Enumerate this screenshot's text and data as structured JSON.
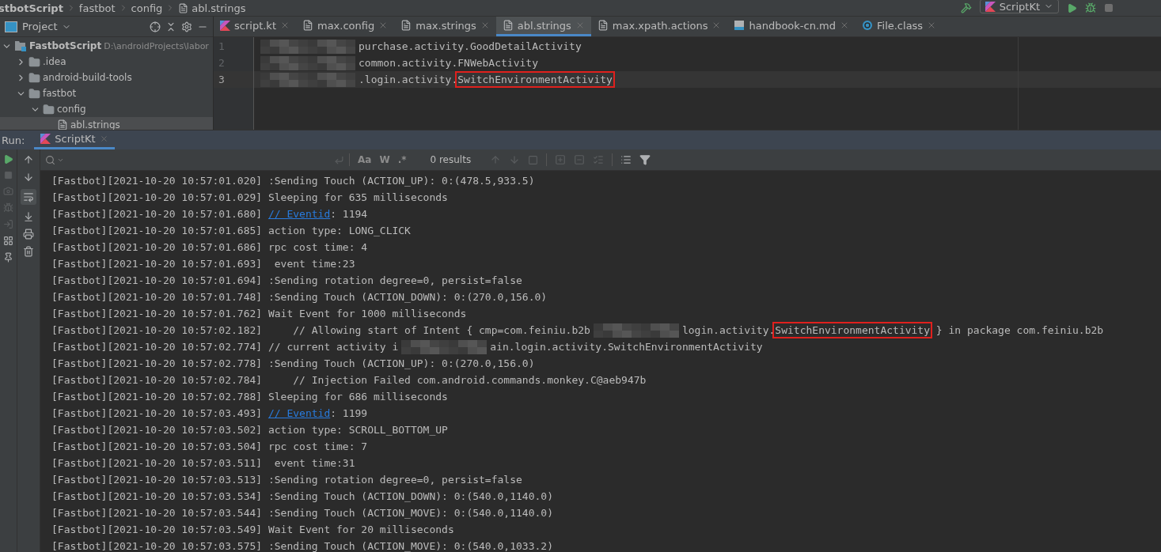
{
  "breadcrumb": [
    "stbotScript",
    "fastbot",
    "config",
    "abl.strings"
  ],
  "toolbar": {
    "run_config": "ScriptKt"
  },
  "project_panel": {
    "title": "Project",
    "tree": [
      {
        "label": "FastbotScript",
        "path": "D:\\androidProjects\\labor",
        "kind": "module",
        "expanded": true,
        "selected": false,
        "children": [
          {
            "label": ".idea",
            "kind": "folder",
            "expanded": false,
            "selected": false
          },
          {
            "label": "android-build-tools",
            "kind": "folder",
            "expanded": false,
            "selected": false
          },
          {
            "label": "fastbot",
            "kind": "folder",
            "expanded": true,
            "selected": false,
            "children": [
              {
                "label": "config",
                "kind": "folder",
                "expanded": true,
                "selected": false,
                "children": [
                  {
                    "label": "abl.strings",
                    "kind": "file",
                    "selected": true
                  }
                ]
              }
            ]
          }
        ]
      }
    ]
  },
  "editor": {
    "tabs": [
      {
        "label": "script.kt",
        "kind": "kotlin",
        "selected": false
      },
      {
        "label": "max.config",
        "kind": "text",
        "selected": false
      },
      {
        "label": "max.strings",
        "kind": "text",
        "selected": false
      },
      {
        "label": "abl.strings",
        "kind": "text",
        "selected": true
      },
      {
        "label": "max.xpath.actions",
        "kind": "text",
        "selected": false
      },
      {
        "label": "handbook-cn.md",
        "kind": "markdown",
        "selected": false
      },
      {
        "label": "File.class",
        "kind": "class",
        "selected": false
      }
    ],
    "lines": [
      {
        "number": "1",
        "current": false,
        "parts": [
          {
            "kind": "redacted"
          },
          {
            "kind": "text",
            "text": "purchase.activity.GoodDetailActivity"
          }
        ]
      },
      {
        "number": "2",
        "current": false,
        "parts": [
          {
            "kind": "redacted"
          },
          {
            "kind": "text",
            "text": "common.activity.FNWebActivity"
          }
        ]
      },
      {
        "number": "3",
        "current": true,
        "parts": [
          {
            "kind": "redacted"
          },
          {
            "kind": "text",
            "text": ".login.activity."
          },
          {
            "kind": "boxed",
            "text": "SwitchEnvironmentActivity"
          }
        ]
      }
    ]
  },
  "run": {
    "label": "Run:",
    "tab": "ScriptKt",
    "search": {
      "results": "0 results",
      "options": [
        "Aa",
        "W",
        ".*"
      ]
    },
    "log": [
      {
        "time": "[Fastbot][2021-10-20 10:57:01.020]",
        "parts": [
          {
            "kind": "text",
            "text": ":Sending Touch (ACTION_UP): 0:(478.5,933.5)"
          }
        ]
      },
      {
        "time": "[Fastbot][2021-10-20 10:57:01.029]",
        "parts": [
          {
            "kind": "text",
            "text": "Sleeping for 635 milliseconds"
          }
        ]
      },
      {
        "time": "[Fastbot][2021-10-20 10:57:01.680]",
        "parts": [
          {
            "kind": "link",
            "text": "// Eventid"
          },
          {
            "kind": "text",
            "text": ": 1194"
          }
        ]
      },
      {
        "time": "[Fastbot][2021-10-20 10:57:01.685]",
        "parts": [
          {
            "kind": "text",
            "text": "action type: LONG_CLICK"
          }
        ]
      },
      {
        "time": "[Fastbot][2021-10-20 10:57:01.686]",
        "parts": [
          {
            "kind": "text",
            "text": "rpc cost time: 4"
          }
        ]
      },
      {
        "time": "[Fastbot][2021-10-20 10:57:01.693]",
        "parts": [
          {
            "kind": "text",
            "text": " event time:23"
          }
        ]
      },
      {
        "time": "[Fastbot][2021-10-20 10:57:01.694]",
        "parts": [
          {
            "kind": "text",
            "text": ":Sending rotation degree=0, persist=false"
          }
        ]
      },
      {
        "time": "[Fastbot][2021-10-20 10:57:01.748]",
        "parts": [
          {
            "kind": "text",
            "text": ":Sending Touch (ACTION_DOWN): 0:(270.0,156.0)"
          }
        ]
      },
      {
        "time": "[Fastbot][2021-10-20 10:57:01.762]",
        "parts": [
          {
            "kind": "text",
            "text": "Wait Event for 1000 milliseconds"
          }
        ]
      },
      {
        "time": "[Fastbot][2021-10-20 10:57:02.182]",
        "parts": [
          {
            "kind": "text",
            "text": "    // Allowing start of Intent { cmp=com.feiniu.b2b"
          },
          {
            "kind": "redacted"
          },
          {
            "kind": "text",
            "text": "login.activity."
          },
          {
            "kind": "boxed",
            "text": "SwitchEnvironmentActivity"
          },
          {
            "kind": "text",
            "text": " } in package com.feiniu.b2b"
          }
        ]
      },
      {
        "time": "[Fastbot][2021-10-20 10:57:02.774]",
        "parts": [
          {
            "kind": "text",
            "text": "// current activity i"
          },
          {
            "kind": "redacted"
          },
          {
            "kind": "text",
            "text": "ain.login.activity.SwitchEnvironmentActivity"
          }
        ]
      },
      {
        "time": "[Fastbot][2021-10-20 10:57:02.778]",
        "parts": [
          {
            "kind": "text",
            "text": ":Sending Touch (ACTION_UP): 0:(270.0,156.0)"
          }
        ]
      },
      {
        "time": "[Fastbot][2021-10-20 10:57:02.784]",
        "parts": [
          {
            "kind": "text",
            "text": "    // Injection Failed com.android.commands.monkey.C@aeb947b"
          }
        ]
      },
      {
        "time": "[Fastbot][2021-10-20 10:57:02.788]",
        "parts": [
          {
            "kind": "text",
            "text": "Sleeping for 686 milliseconds"
          }
        ]
      },
      {
        "time": "[Fastbot][2021-10-20 10:57:03.493]",
        "parts": [
          {
            "kind": "link",
            "text": "// Eventid"
          },
          {
            "kind": "text",
            "text": ": 1199"
          }
        ]
      },
      {
        "time": "[Fastbot][2021-10-20 10:57:03.502]",
        "parts": [
          {
            "kind": "text",
            "text": "action type: SCROLL_BOTTOM_UP"
          }
        ]
      },
      {
        "time": "[Fastbot][2021-10-20 10:57:03.504]",
        "parts": [
          {
            "kind": "text",
            "text": "rpc cost time: 7"
          }
        ]
      },
      {
        "time": "[Fastbot][2021-10-20 10:57:03.511]",
        "parts": [
          {
            "kind": "text",
            "text": " event time:31"
          }
        ]
      },
      {
        "time": "[Fastbot][2021-10-20 10:57:03.513]",
        "parts": [
          {
            "kind": "text",
            "text": ":Sending rotation degree=0, persist=false"
          }
        ]
      },
      {
        "time": "[Fastbot][2021-10-20 10:57:03.534]",
        "parts": [
          {
            "kind": "text",
            "text": ":Sending Touch (ACTION_DOWN): 0:(540.0,1140.0)"
          }
        ]
      },
      {
        "time": "[Fastbot][2021-10-20 10:57:03.544]",
        "parts": [
          {
            "kind": "text",
            "text": ":Sending Touch (ACTION_MOVE): 0:(540.0,1140.0)"
          }
        ]
      },
      {
        "time": "[Fastbot][2021-10-20 10:57:03.549]",
        "parts": [
          {
            "kind": "text",
            "text": "Wait Event for 20 milliseconds"
          }
        ]
      },
      {
        "time": "[Fastbot][2021-10-20 10:57:03.575]",
        "parts": [
          {
            "kind": "text",
            "text": ":Sending Touch (ACTION_MOVE): 0:(540.0,1033.2)"
          }
        ]
      }
    ]
  }
}
